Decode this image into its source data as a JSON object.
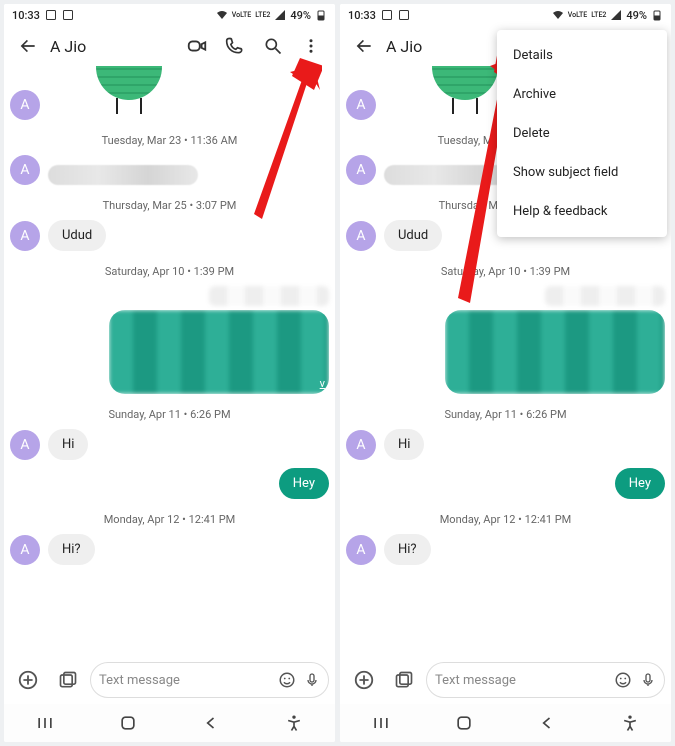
{
  "status": {
    "time": "10:33",
    "battery": "49%",
    "network": "LTE2"
  },
  "header": {
    "contact": "A Jio",
    "avatar_letter": "A"
  },
  "messages": {
    "ts1": "Tuesday, Mar 23 • 11:36 AM",
    "ts2": "Thursday, Mar 25 • 3:07 PM",
    "m_udud": "Udud",
    "ts3": "Saturday, Apr 10 • 1:39 PM",
    "ts4": "Sunday, Apr 11 • 6:26 PM",
    "m_hi": "Hi",
    "m_hey": "Hey",
    "ts5": "Monday, Apr 12 • 12:41 PM",
    "m_hi2": "Hi?"
  },
  "compose": {
    "placeholder": "Text message"
  },
  "menu": {
    "details": "Details",
    "archive": "Archive",
    "delete": "Delete",
    "subject": "Show subject field",
    "help": "Help & feedback"
  }
}
